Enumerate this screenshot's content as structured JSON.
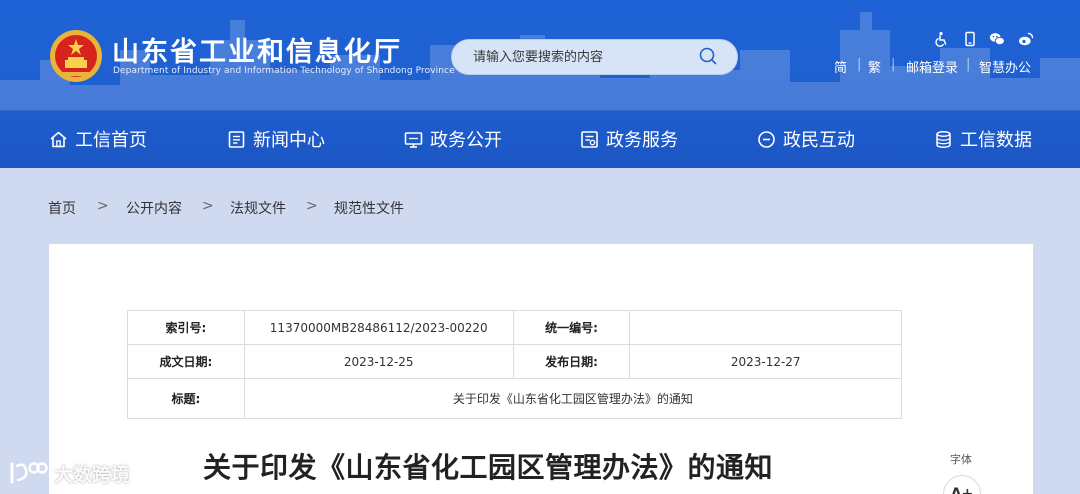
{
  "site": {
    "title": "山东省工业和信息化厅",
    "subtitle": "Department of Industry and Information Technology of Shandong Province"
  },
  "search": {
    "placeholder": "请输入您要搜索的内容"
  },
  "top_links": {
    "simplified": "简",
    "traditional": "繁",
    "mail_login": "邮箱登录",
    "smart_office": "智慧办公",
    "separator": "|"
  },
  "nav": [
    {
      "label": "工信首页",
      "icon": "home-icon"
    },
    {
      "label": "新闻中心",
      "icon": "news-icon"
    },
    {
      "label": "政务公开",
      "icon": "monitor-icon"
    },
    {
      "label": "政务服务",
      "icon": "service-icon"
    },
    {
      "label": "政民互动",
      "icon": "chat-icon"
    },
    {
      "label": "工信数据",
      "icon": "database-icon"
    }
  ],
  "breadcrumb": {
    "items": [
      "首页",
      "公开内容",
      "法规文件",
      "规范性文件"
    ],
    "separator": ">"
  },
  "meta": {
    "index_no_label": "索引号:",
    "index_no": "11370000MB28486112/2023-00220",
    "unified_no_label": "统一编号:",
    "unified_no": "",
    "created_label": "成文日期:",
    "created": "2023-12-25",
    "published_label": "发布日期:",
    "published": "2023-12-27",
    "title_label": "标题:",
    "title": "关于印发《山东省化工园区管理办法》的通知"
  },
  "document": {
    "title": "关于印发《山东省化工园区管理办法》的通知"
  },
  "font_control": {
    "label": "字体",
    "increase": "A+"
  },
  "watermark": {
    "text": "大数跨境"
  },
  "colors": {
    "header_blue": "#1e63d6",
    "page_bg": "#cfdaf0"
  }
}
